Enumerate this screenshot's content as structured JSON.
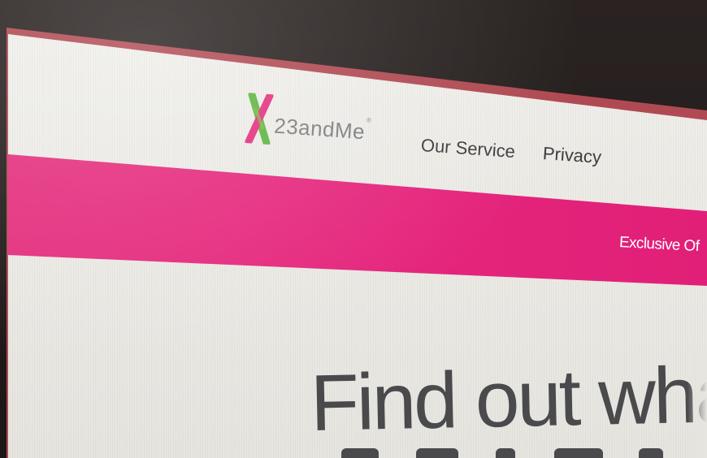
{
  "header": {
    "logo": {
      "text": "23andMe",
      "registered": "®",
      "colors": {
        "green": "#5fb541",
        "pink": "#e4317f"
      }
    },
    "nav": {
      "items": [
        {
          "label": "Our Service"
        },
        {
          "label": "Privacy"
        }
      ]
    }
  },
  "promo_banner": {
    "text": "Exclusive Of",
    "color": "#e4317f"
  },
  "hero": {
    "headline": "Find out what y"
  }
}
